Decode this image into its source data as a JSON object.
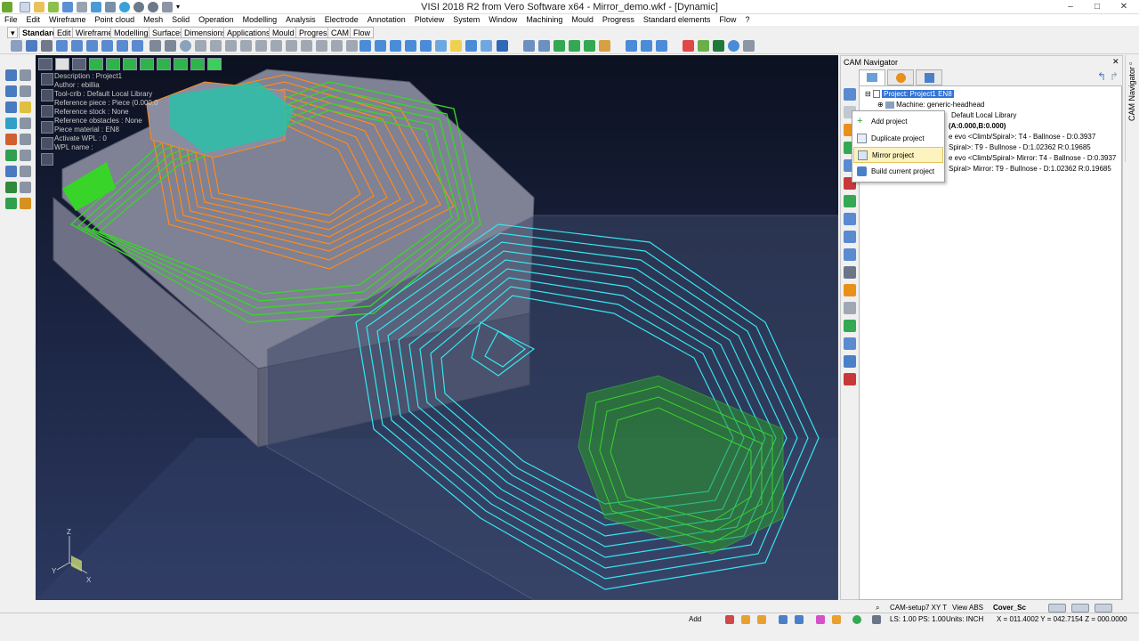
{
  "window": {
    "title": "VISI 2018 R2 from Vero Software x64 - Mirror_demo.wkf - [Dynamic]",
    "controls": [
      "–",
      "□",
      "✕"
    ]
  },
  "menu": [
    "File",
    "Edit",
    "Wireframe",
    "Point cloud",
    "Mesh",
    "Solid",
    "Operation",
    "Modelling",
    "Analysis",
    "Electrode",
    "Annotation",
    "Plotview",
    "System",
    "Window",
    "Machining",
    "Mould",
    "Progress",
    "Standard elements",
    "Flow",
    "?"
  ],
  "tabs": [
    "Standard",
    "Edit",
    "Wireframe",
    "Modelling",
    "Surfaces",
    "Dimensions",
    "Applications",
    "Mould",
    "Progress",
    "CAM",
    "Flow"
  ],
  "active_tab": "Standard",
  "viewport_info": [
    "Description : Project1",
    "Author : ebillia",
    "Tool-crib : Default Local Library",
    "Reference piece : Piece (0.000,0",
    "Reference stock : None",
    "Reference obstacles : None",
    "Piece material : EN8",
    "Activate WPL : 0",
    "WPL name :"
  ],
  "axis_labels": {
    "z": "Z",
    "y": "Y",
    "x": "X"
  },
  "navigator": {
    "title": "CAM Navigator",
    "side_tab": "CAM Navigator",
    "tree": {
      "project": "Project: Project1 EN8",
      "machine": "Machine: generic-headhead",
      "tool_library": "Default Local Library",
      "setup": "(A:0.000,B:0.000)",
      "ops": [
        "e evo <Climb/Spiral>: T4 - Ballnose - D:0.3937",
        "Spiral>: T9 - Bullnose - D:1.02362 R:0.19685",
        "e evo <Climb/Spiral> Mirror: T4 - Ballnose - D:0.3937",
        "Spiral> Mirror: T9 - Bullnose - D:1.02362 R:0.19685"
      ]
    },
    "footer": [
      "CAM-setup7 XY T",
      "View ABS",
      "Cover_Sc"
    ]
  },
  "context_menu": {
    "items": [
      "Add project",
      "Duplicate project",
      "Mirror project",
      "Build current project"
    ],
    "highlighted": "Mirror project"
  },
  "status": {
    "command": "Add",
    "ls": "LS: 1.00 PS: 1.00",
    "units": "Units: INCH",
    "coords": "X = 011.4002 Y = 042.7154 Z = 000.0000"
  },
  "colors": {
    "toolpath_green": "#39d42a",
    "toolpath_orange": "#ff8a1a",
    "toolpath_cyan": "#35e6f0",
    "model": "#7f8194",
    "background": "#1c2541",
    "selection": "#3374d6"
  }
}
